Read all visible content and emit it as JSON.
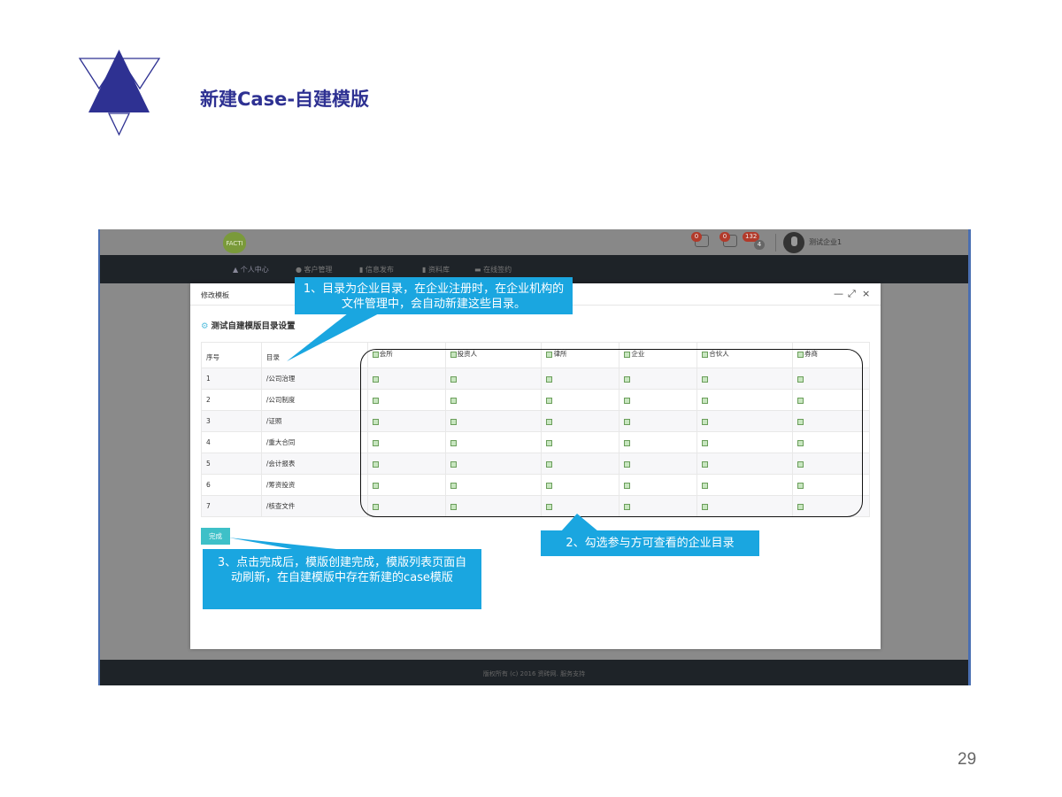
{
  "slide": {
    "title": "新建Case-自建模版",
    "page_number": "29"
  },
  "app": {
    "logo_text": "FACTI",
    "badges": [
      "0",
      "0",
      "132",
      "4"
    ],
    "user_name": "测试企业1",
    "nav": [
      "个人中心",
      "客户管理",
      "信息发布",
      "资料库",
      "在线签约"
    ],
    "footer": "版权所有 (c) 2016 资砖网. 服务支持"
  },
  "modal": {
    "title": "修改模板",
    "controls": [
      "—",
      "⤢",
      "×"
    ],
    "section_title": "测试自建模版目录设置",
    "columns": {
      "index": "序号",
      "directory": "目录",
      "parties": [
        "会所",
        "投资人",
        "律所",
        "企业",
        "合伙人",
        "券商"
      ]
    },
    "rows": [
      {
        "index": "1",
        "directory": "/公司治理"
      },
      {
        "index": "2",
        "directory": "/公司制度"
      },
      {
        "index": "3",
        "directory": "/证照"
      },
      {
        "index": "4",
        "directory": "/重大合同"
      },
      {
        "index": "5",
        "directory": "/会计报表"
      },
      {
        "index": "6",
        "directory": "/筹资投资"
      },
      {
        "index": "7",
        "directory": "/核查文件"
      }
    ],
    "done_button": "完成"
  },
  "callouts": {
    "c1": "1、目录为企业目录，在企业注册时，在企业机构的文件管理中，会自动新建这些目录。",
    "c2": "2、勾选参与方可查看的企业目录",
    "c3": "3、点击完成后，模版创建完成，模版列表页面自动刷新，在自建模版中存在新建的case模版"
  },
  "colors": {
    "title": "#2e3192",
    "callout": "#1aa6e0",
    "done_button": "#3ec0c8"
  }
}
